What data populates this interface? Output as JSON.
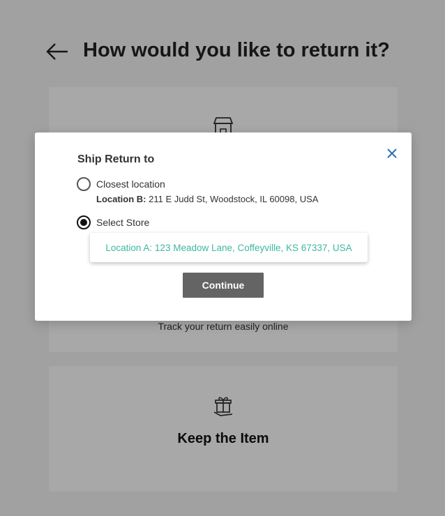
{
  "page": {
    "title": "How would you like to return it?",
    "store_card_subtitle": "Track your return easily online",
    "keep_card_title": "Keep the Item"
  },
  "modal": {
    "title": "Ship Return to",
    "options": [
      {
        "label": "Closest location",
        "selected": false,
        "location_prefix": "Location B:",
        "location_address": "211 E Judd St, Woodstock, IL 60098, USA"
      },
      {
        "label": "Select Store",
        "selected": true,
        "store_choice": "Location A: 123 Meadow Lane, Coffeyville, KS 67337, USA"
      }
    ],
    "continue_label": "Continue"
  },
  "icons": {
    "back": "arrow-left-icon",
    "close": "close-icon",
    "store": "store-icon",
    "keep": "gift-icon"
  },
  "colors": {
    "accent_link": "#3cb99b",
    "close_icon": "#2f6fb3",
    "button_bg": "#646464"
  }
}
